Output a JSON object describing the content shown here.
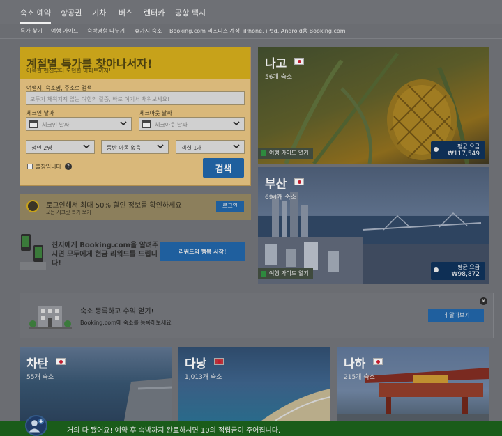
{
  "top_nav": [
    "숙소 예약",
    "항공권",
    "기차",
    "버스",
    "렌터카",
    "공항 택시"
  ],
  "sub_nav": [
    "특가 찾기",
    "여행 가이드",
    "숙박경험 나누기",
    "휴가지 숙소",
    "Booking.com 비즈니스 계정",
    "iPhone, iPad, Android용 Booking.com"
  ],
  "search": {
    "title": "계절별 특가를 찾아나서자!",
    "subtitle": "아늑한 펜션부터 모던한 아파트까지!",
    "dest_label": "여행지, 숙소명, 주소로 검색",
    "dest_placeholder": "모두가 채워지지 않는 여행의 갈증, 바로 여기서 채워보세요!",
    "checkin_label": "체크인 날짜",
    "checkin_placeholder": "체크인 날짜",
    "checkout_label": "체크아웃 날짜",
    "checkout_placeholder": "체크아웃 날짜",
    "adults": "성인 2명",
    "children": "동반 아동 없음",
    "rooms": "객실 1개",
    "business_trip": "출장입니다",
    "submit": "검색"
  },
  "login_banner": {
    "title": "로그인해서 최대 50% 할인 정보를 확인하세요",
    "subtitle": "모든 시크릿 특가 보기",
    "button": "로그인"
  },
  "referral": {
    "text": "친지에게 Booking.com을 알려주시면 모두에게 현금 리워드를 드립니다!",
    "button": "리워드의 행복 시작!"
  },
  "list_property": {
    "title": "숙소 등록하고 수익 얻기!",
    "subtitle": "Booking.com에 숙소를 등록해보세요",
    "button": "더 알아보기"
  },
  "destinations": [
    {
      "name": "나고",
      "count": "56개 숙소",
      "guide": "여행 가이드 열기",
      "price_label": "평균 요금",
      "price": "₩117,549"
    },
    {
      "name": "부산",
      "count": "694개 숙소",
      "guide": "여행 가이드 열기",
      "price_label": "평균 요금",
      "price": "₩98,872"
    },
    {
      "name": "차탄",
      "count": "55개 숙소"
    },
    {
      "name": "다낭",
      "count": "1,013개 숙소"
    },
    {
      "name": "나하",
      "count": "215개 숙소"
    }
  ],
  "bottom_bar": {
    "text": "거의 다 됐어요! 예약 후 숙박까지 완료하시면 10의 적립금이 주어집니다."
  }
}
